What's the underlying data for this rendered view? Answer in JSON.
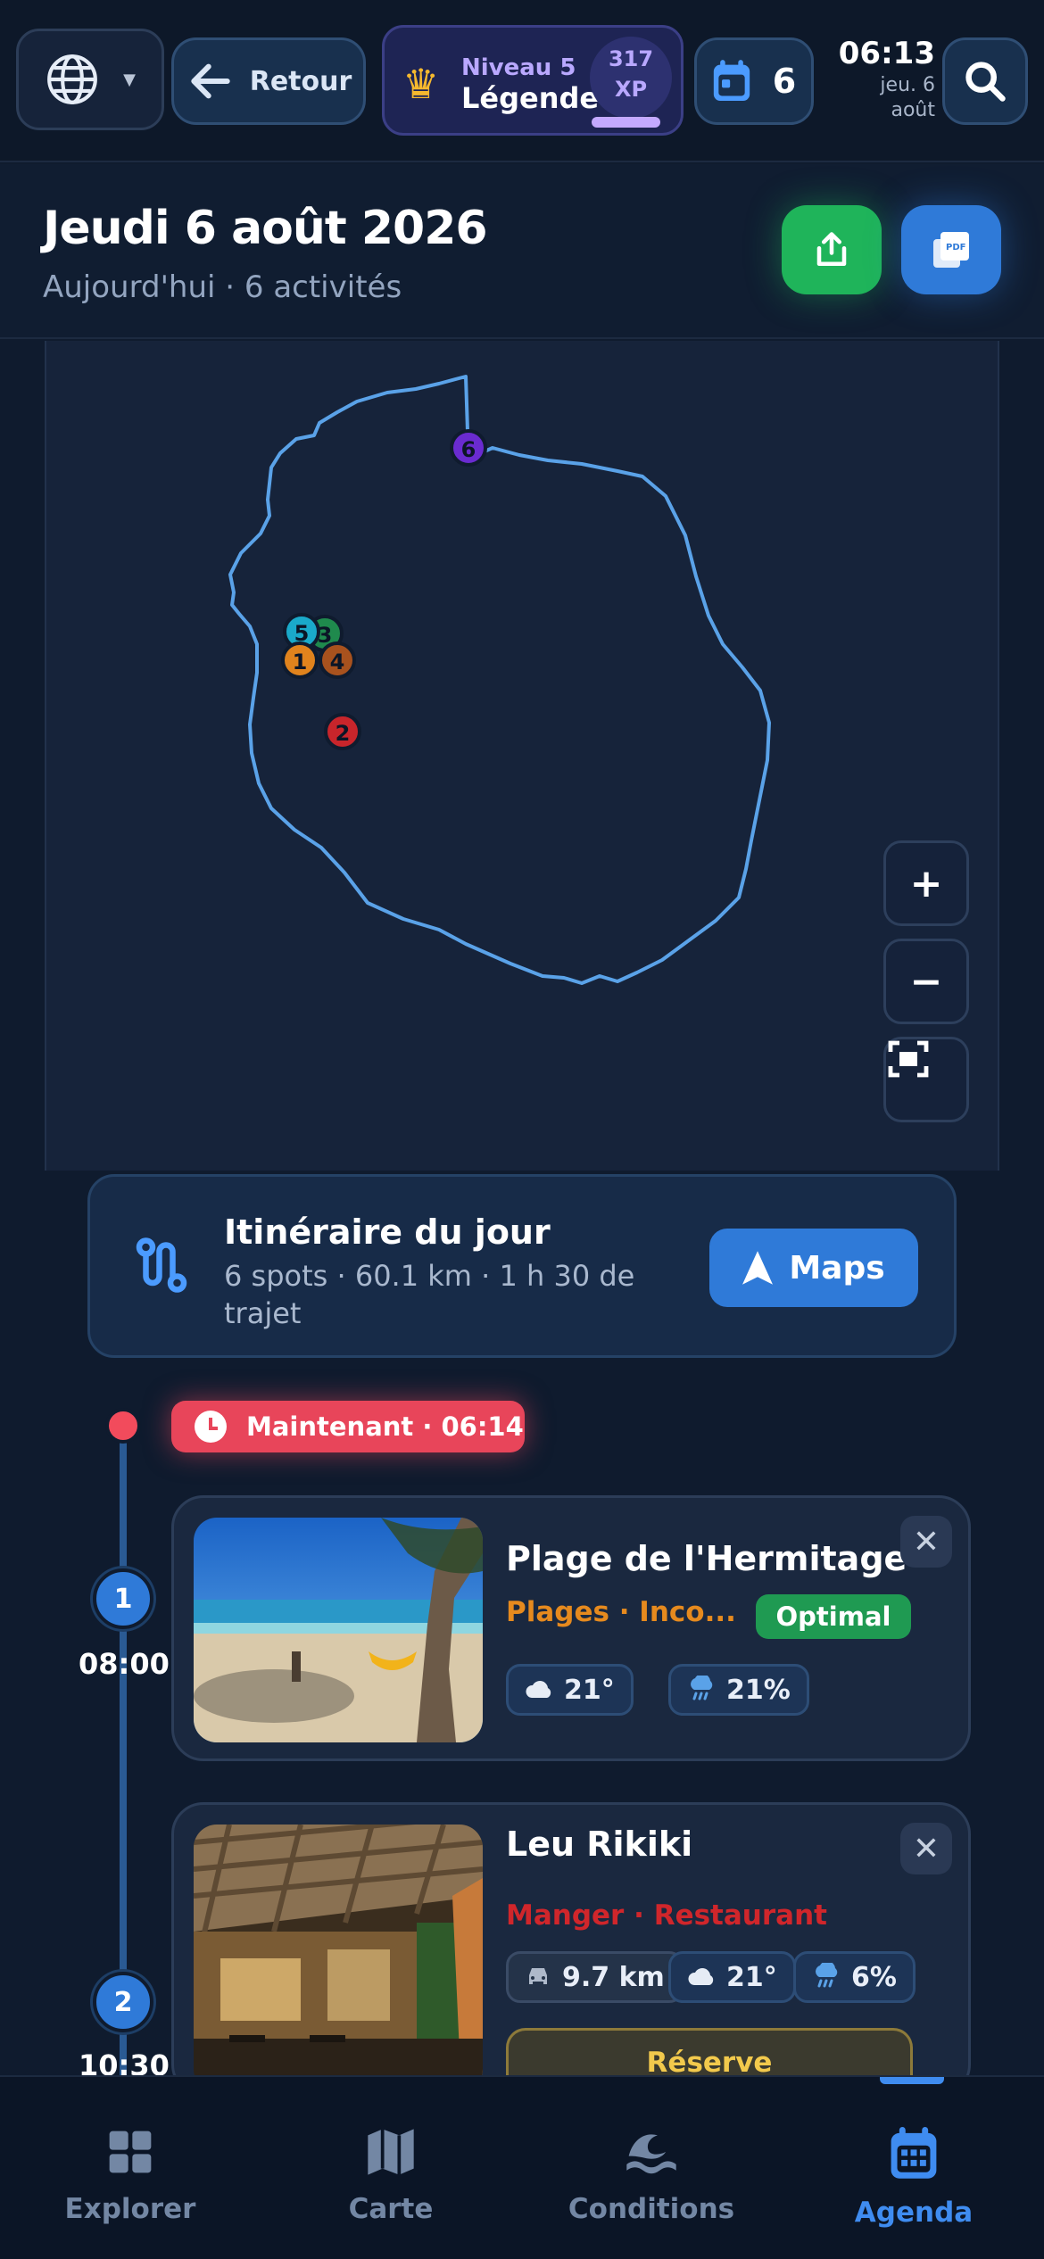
{
  "topbar": {
    "back_label": "Retour",
    "level_label": "Niveau 5",
    "level_rank": "Légende",
    "xp_value": "317",
    "xp_label": "XP",
    "xp_progress": 0.82,
    "calendar_count": "6",
    "clock_time": "06:13",
    "clock_date_line1": "jeu. 6",
    "clock_date_line2": "août"
  },
  "header": {
    "title": "Jeudi 6 août 2026",
    "subtitle": "Aujourd'hui · 6 activités"
  },
  "map": {
    "markers": [
      {
        "label": "6",
        "color": "#6a2bd0"
      },
      {
        "label": "3",
        "color": "#1f8a4d"
      },
      {
        "label": "5",
        "color": "#1aa9c9"
      },
      {
        "label": "1",
        "color": "#e0831d"
      },
      {
        "label": "4",
        "color": "#a8521e"
      },
      {
        "label": "2",
        "color": "#c8252b"
      }
    ],
    "zoom_in": "+",
    "zoom_out": "−"
  },
  "itinerary": {
    "title": "Itinéraire du jour",
    "subtitle": "6 spots · 60.1 km · 1 h 30 de trajet",
    "maps_label": "Maps"
  },
  "timeline": {
    "now_label": "Maintenant · 06:14"
  },
  "activities": [
    {
      "number": "1",
      "time": "08:00",
      "title": "Plage de l'Hermitage",
      "category": "Plages · Inco...",
      "badge": "Optimal",
      "temp": "21°",
      "rain": "21%"
    },
    {
      "number": "2",
      "time": "10:30",
      "title": "Leu Rikiki",
      "category": "Manger · Restaurant",
      "distance": "9.7 km",
      "temp": "21°",
      "rain": "6%",
      "reserve_label": "Réserve"
    }
  ],
  "nav": {
    "items": [
      {
        "label": "Explorer"
      },
      {
        "label": "Carte"
      },
      {
        "label": "Conditions"
      },
      {
        "label": "Agenda"
      }
    ],
    "active": "Agenda"
  },
  "colors": {
    "accent": "#2f7ad8",
    "route": "#5aa2e8",
    "now": "#e8455a",
    "optimal": "#1f9a52",
    "share": "#1fb45a"
  }
}
